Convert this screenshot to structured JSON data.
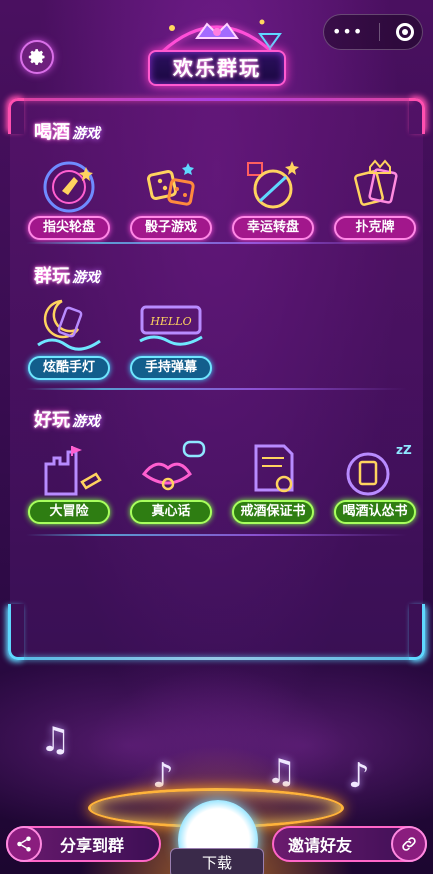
{
  "header": {
    "status_text": "",
    "title": "欢乐群玩"
  },
  "sections": [
    {
      "title_big": "喝酒",
      "title_small": "游戏",
      "games": [
        "指尖轮盘",
        "骰子游戏",
        "幸运转盘",
        "扑克牌"
      ]
    },
    {
      "title_big": "群玩",
      "title_small": "游戏",
      "games": [
        "炫酷手灯",
        "手持弹幕"
      ]
    },
    {
      "title_big": "好玩",
      "title_small": "游戏",
      "games": [
        "大冒险",
        "真心话",
        "戒酒保证书",
        "喝酒认怂书"
      ]
    }
  ],
  "icons": {
    "settings": "gear-icon",
    "share": "share-icon",
    "invite": "link-icon",
    "menu": "more-dots-icon",
    "close": "target-circle-icon"
  },
  "footer": {
    "share_label": "分享到群",
    "invite_label": "邀请好友",
    "download_label": "下载"
  },
  "colors": {
    "pink_neon": "#ff4fd8",
    "blue_neon": "#5fd8ff",
    "green_neon": "#a8ff5e",
    "background": "#2a0a3c"
  }
}
